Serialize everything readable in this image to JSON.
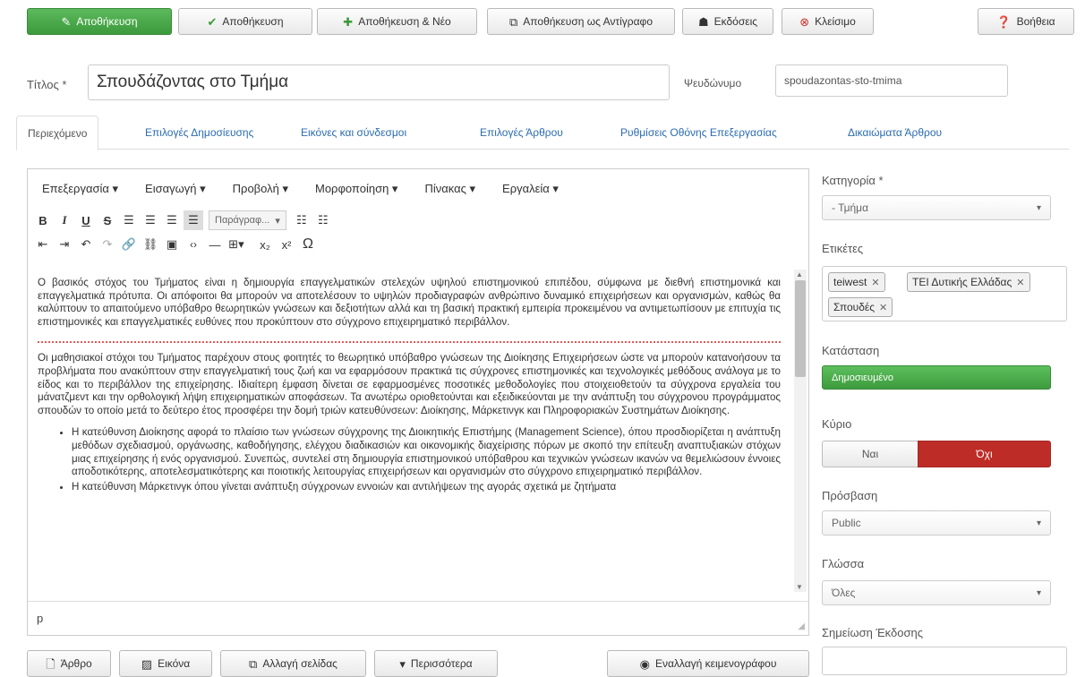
{
  "toolbar": {
    "save_edit": "Αποθήκευση",
    "save": "Αποθήκευση",
    "save_new": "Αποθήκευση & Νέο",
    "save_copy": "Αποθήκευση ως Αντίγραφο",
    "versions": "Εκδόσεις",
    "close": "Κλείσιμο",
    "help": "Βοήθεια"
  },
  "form": {
    "title_label": "Τίτλος *",
    "title_value": "Σπουδάζοντας στο Τμήμα",
    "alias_label": "Ψευδώνυμο",
    "alias_value": "spoudazontas-sto-tmima"
  },
  "tabs": [
    {
      "label": "Περιεχόμενο"
    },
    {
      "label": "Επιλογές Δημοσίευσης"
    },
    {
      "label": "Εικόνες και σύνδεσμοι"
    },
    {
      "label": "Επιλογές Άρθρου"
    },
    {
      "label": "Ρυθμίσεις Οθόνης Επεξεργασίας"
    },
    {
      "label": "Δικαιώματα Άρθρου"
    }
  ],
  "editor": {
    "menu": [
      "Επεξεργασία ▾",
      "Εισαγωγή ▾",
      "Προβολή ▾",
      "Μορφοποίηση ▾",
      "Πίνακας ▾",
      "Εργαλεία ▾"
    ],
    "format_select": "Παράγραφ...",
    "paragraph1": "Ο βασικός στόχος του Τμήματος είναι η δημιουργία επαγγελματικών στελεχών υψηλού επιστημονικού επιπέδου, σύμφωνα με διεθνή επιστημονικά και επαγγελματικά πρότυπα. Οι απόφοιτοι θα μπορούν να αποτελέσουν το υψηλών προδιαγραφών ανθρώπινο δυναμικό επιχειρήσεων και οργανισμών, καθώς θα καλύπτουν το απαιτούμενο υπόβαθρο θεωρητικών γνώσεων και δεξιοτήτων αλλά και τη βασική πρακτική εμπειρία προκειμένου να αντιμετωπίσουν με επιτυχία τις επιστημονικές και επαγγελματικές ευθύνες που προκύπτουν στο σύγχρονο επιχειρηματικό περιβάλλον.",
    "paragraph2": "Οι μαθησιακοί στόχοι του Τμήματος παρέχουν στους φοιτητές το θεωρητικό υπόβαθρο γνώσεων της Διοίκησης Επιχειρήσεων ώστε να μπορούν κατανοήσουν τα προβλήματα που ανακύπτουν στην επαγγελματική τους ζωή και να εφαρμόσουν πρακτικά τις σύγχρονες επιστημονικές και τεχνολογικές μεθόδους ανάλογα με το είδος και το περιβάλλον της επιχείρησης. Ιδιαίτερη έμφαση δίνεται σε εφαρμοσμένες ποσοτικές μεθοδολογίες που στοιχειοθετούν τα σύγχρονα εργαλεία του μάνατζμεντ και την ορθολογική λήψη επιχειρηματικών αποφάσεων. Τα ανωτέρω οριοθετούνται και εξειδικεύονται με την ανάπτυξη του σύγχρονου προγράμματος σπουδών το οποίο μετά το δεύτερο έτος προσφέρει την δομή τριών κατευθύνσεων: Διοίκησης, Μάρκετινγκ και Πληροφοριακών Συστημάτων Διοίκησης.",
    "bullet1": "Η κατεύθυνση Διοίκησης αφορά το πλαίσιο των γνώσεων σύγχρονης της Διοικητικής Επιστήμης (Management Science), όπου προσδιορίζεται η ανάπτυξη μεθόδων σχεδιασμού, οργάνωσης, καθοδήγησης, ελέγχου διαδικασιών και οικονομικής διαχείρισης πόρων με σκοπό την επίτευξη αναπτυξιακών στόχων μιας επιχείρησης ή ενός οργανισμού. Συνεπώς, συντελεί στη δημιουργία επιστημονικού υπόβαθρου και τεχνικών γνώσεων ικανών να θεμελιώσουν έννοιες αποδοτικότερης, αποτελεσματικότερης και ποιοτικής λειτουργίας επιχειρήσεων και οργανισμών στο σύγχρονο επιχειρηματικό περιβάλλον.",
    "bullet2": "Η κατεύθυνση Μάρκετινγκ όπου γίνεται ανάπτυξη σύγχρονων εννοιών και αντιλήψεων της αγοράς σχετικά με ζητήματα",
    "path": "p"
  },
  "bottom_buttons": {
    "article": "Άρθρο",
    "image": "Εικόνα",
    "pagebreak": "Αλλαγή σελίδας",
    "more": "Περισσότερα",
    "toggle_editor": "Εναλλαγή κειμενογράφου"
  },
  "sidebar": {
    "category_label": "Κατηγορία *",
    "category_value": "- Τμήμα",
    "tags_label": "Ετικέτες",
    "tags": [
      "teiwest",
      "ΤΕΙ Δυτικής Ελλάδας",
      "Σπουδές"
    ],
    "status_label": "Κατάσταση",
    "status_value": "Δημοσιευμένο",
    "featured_label": "Κύριο",
    "featured_yes": "Ναι",
    "featured_no": "Όχι",
    "access_label": "Πρόσβαση",
    "access_value": "Public",
    "language_label": "Γλώσσα",
    "language_value": "Όλες",
    "version_note_label": "Σημείωση Έκδοσης"
  },
  "colors": {
    "primary_green": "#46a546",
    "featured_no_red": "#bd2c27",
    "link_blue": "#2b6cb0"
  }
}
